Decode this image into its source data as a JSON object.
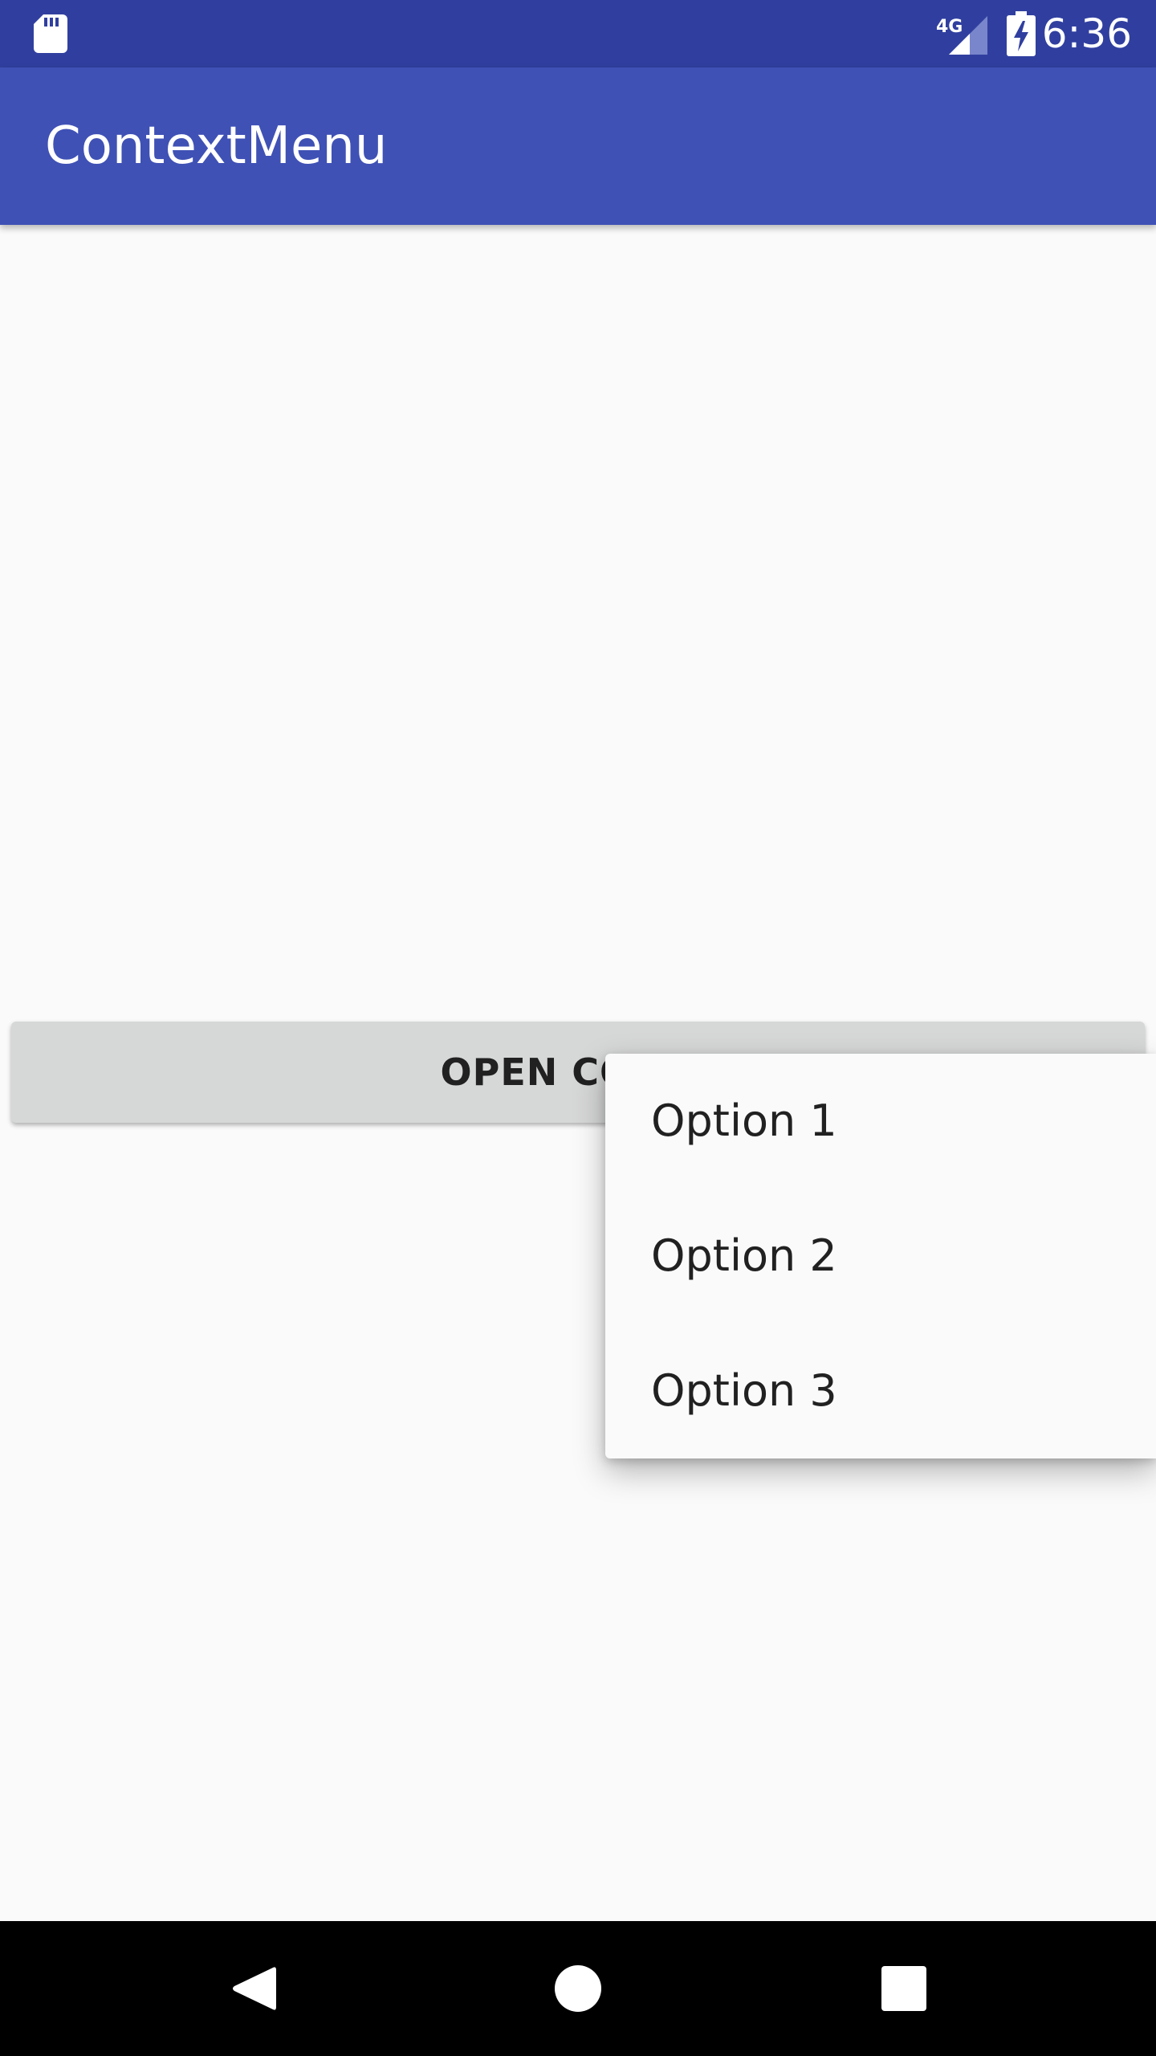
{
  "status_bar": {
    "time": "6:36",
    "network_label": "4G",
    "icons": [
      "sd-card-icon",
      "cellular-signal-icon",
      "battery-charging-icon"
    ],
    "background": "#303f9f"
  },
  "app_bar": {
    "title": "ContextMenu",
    "background": "#3f51b5"
  },
  "main": {
    "button_label": "OPEN CONTE",
    "button_background": "#d6d7d7"
  },
  "context_menu": {
    "items": [
      {
        "label": "Option 1"
      },
      {
        "label": "Option 2"
      },
      {
        "label": "Option 3"
      }
    ]
  },
  "nav_bar": {
    "icons": [
      "back-icon",
      "home-icon",
      "recents-icon"
    ]
  }
}
